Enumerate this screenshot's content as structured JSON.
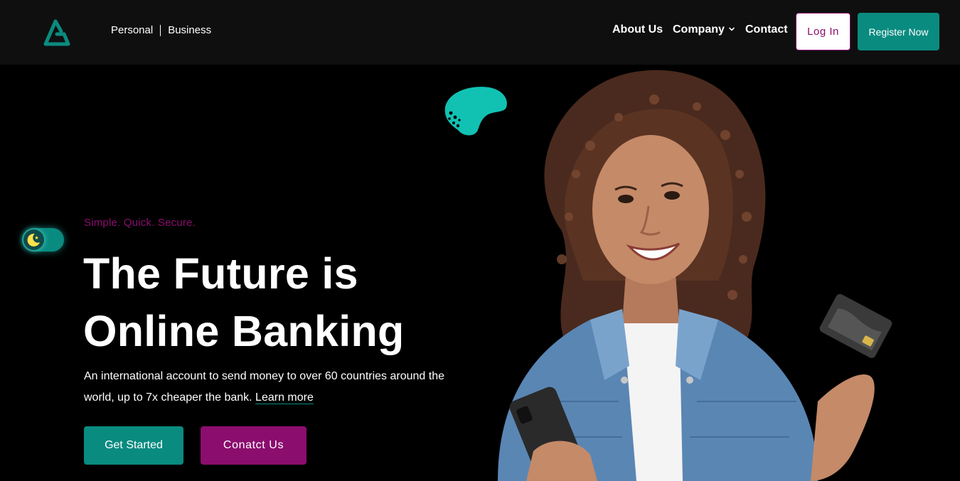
{
  "header": {
    "segment": {
      "personal": "Personal",
      "business": "Business"
    },
    "nav": {
      "about": "About Us",
      "company": "Company",
      "contact": "Contact"
    },
    "login_label": "Log In",
    "register_label": "Register Now"
  },
  "hero": {
    "tagline": "Simple. Quick. Secure.",
    "title_line1": "The Future is",
    "title_line2": "Online Banking",
    "description": "An international account to send money to over 60 countries around the world, up to 7x cheaper the bank.",
    "learn_more": "Learn more",
    "get_started_label": "Get Started",
    "contact_label": "Conatct Us"
  },
  "theme_toggle": {
    "mode": "dark",
    "icon": "moon-star-icon"
  },
  "colors": {
    "accent_teal": "#0a8b80",
    "accent_magenta": "#8b0d6e",
    "header_bg": "#0f0f0f",
    "page_bg": "#000000"
  },
  "icons": {
    "logo": "brand-logo-icon",
    "company_dropdown": "chevron-down-icon"
  }
}
